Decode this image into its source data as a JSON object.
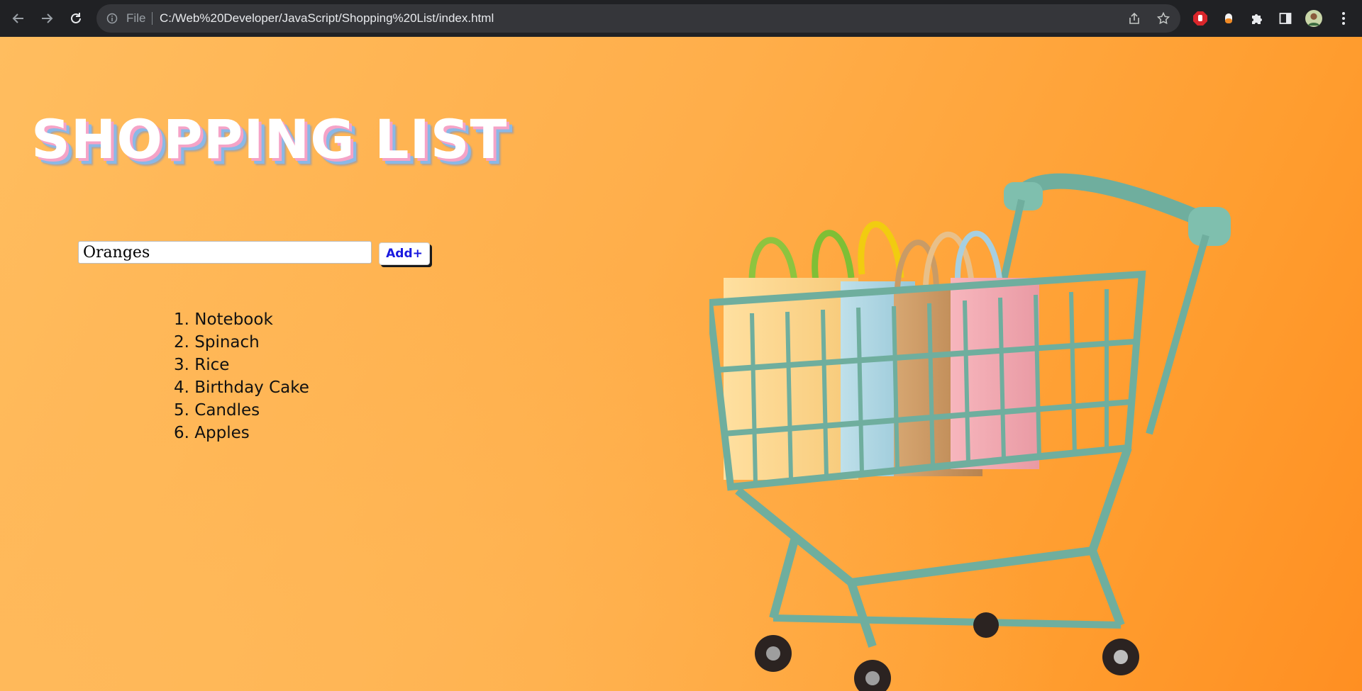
{
  "browser": {
    "file_label": "File",
    "url": "C:/Web%20Developer/JavaScript/Shopping%20List/index.html",
    "icons": [
      "back-arrow-icon",
      "forward-arrow-icon",
      "reload-icon",
      "info-icon",
      "share-icon",
      "star-icon",
      "adblock-extension-icon",
      "extension-icon",
      "puzzle-icon",
      "side-panel-icon",
      "profile-avatar",
      "kebab-menu-icon"
    ]
  },
  "page": {
    "title": "SHOPPING LIST",
    "input": {
      "value": "Oranges"
    },
    "add_button_label": "Add+",
    "items": [
      {
        "number": "1.",
        "label": "Notebook"
      },
      {
        "number": "2.",
        "label": "Spinach"
      },
      {
        "number": "3.",
        "label": "Rice"
      },
      {
        "number": "4.",
        "label": "Birthday Cake"
      },
      {
        "number": "5.",
        "label": "Candles"
      },
      {
        "number": "6.",
        "label": "Apples"
      }
    ],
    "colors": {
      "background": "#ffae4a",
      "title": "#ffffff",
      "title_shadow_pink": "#f5a3c7",
      "title_shadow_blue": "#8ab8e6",
      "button_text": "#1a1adf",
      "cart": "#7fbfae"
    }
  }
}
